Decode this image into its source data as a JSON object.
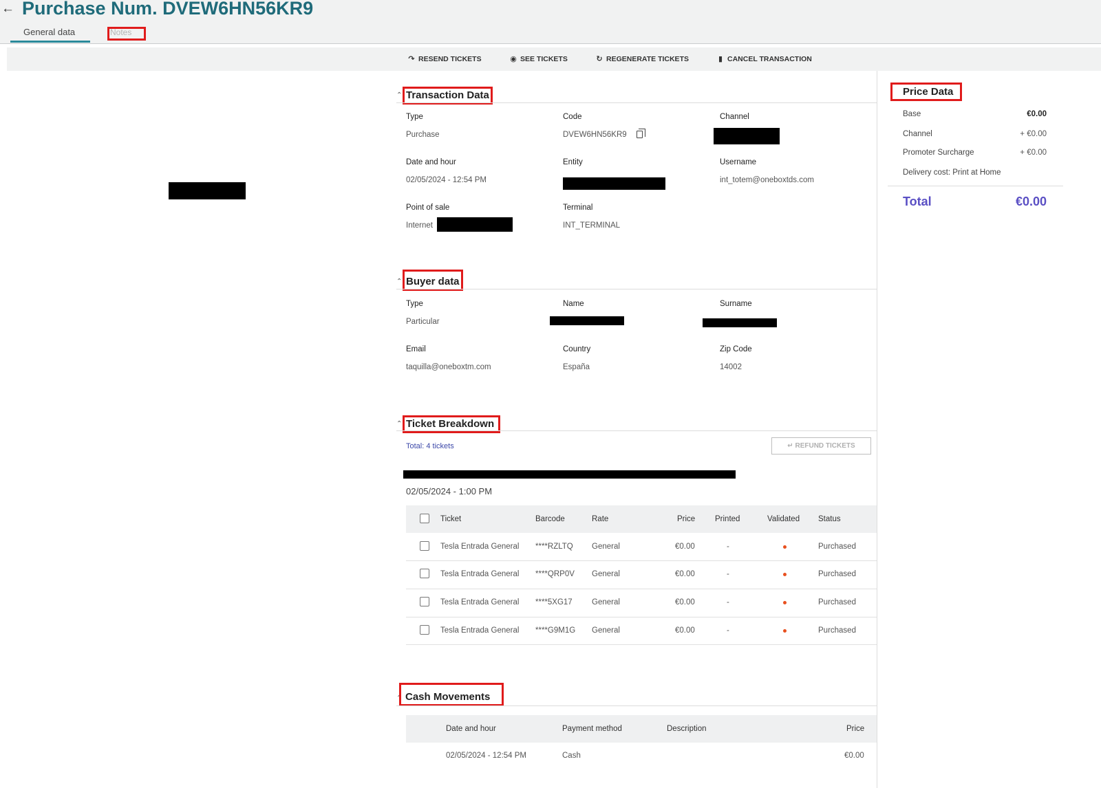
{
  "header": {
    "back_icon": "arrow-left-icon",
    "title": "Purchase Num. DVEW6HN56KR9",
    "tabs": [
      {
        "label": "General data",
        "active": true
      },
      {
        "label": "Notes",
        "active": false
      }
    ]
  },
  "toolbar": {
    "actions": [
      {
        "icon": "resend-icon",
        "label": "RESEND TICKETS"
      },
      {
        "icon": "eye-icon",
        "label": "SEE TICKETS"
      },
      {
        "icon": "refresh-icon",
        "label": "REGENERATE TICKETS"
      },
      {
        "icon": "trash-icon",
        "label": "CANCEL TRANSACTION"
      }
    ]
  },
  "transaction": {
    "title": "Transaction Data",
    "type_label": "Type",
    "type_value": "Purchase",
    "code_label": "Code",
    "code_value": "DVEW6HN56KR9",
    "channel_label": "Channel",
    "date_label": "Date and hour",
    "date_value": "02/05/2024 - 12:54 PM",
    "entity_label": "Entity",
    "username_label": "Username",
    "username_value": "int_totem@oneboxtds.com",
    "pos_label": "Point of sale",
    "pos_value": "Internet",
    "terminal_label": "Terminal",
    "terminal_value": "INT_TERMINAL"
  },
  "buyer": {
    "title": "Buyer data",
    "type_label": "Type",
    "type_value": "Particular",
    "name_label": "Name",
    "surname_label": "Surname",
    "email_label": "Email",
    "email_value": "taquilla@oneboxtm.com",
    "country_label": "Country",
    "country_value": "España",
    "zip_label": "Zip Code",
    "zip_value": "14002"
  },
  "tickets": {
    "title": "Ticket Breakdown",
    "total_text": "Total: 4 tickets",
    "refund_label": "REFUND TICKETS",
    "session_date": "02/05/2024 - 1:00 PM",
    "columns": [
      "Ticket",
      "Barcode",
      "Rate",
      "Price",
      "Printed",
      "Validated",
      "Status"
    ],
    "rows": [
      {
        "ticket": "Tesla Entrada General",
        "barcode": "****RZLTQ",
        "rate": "General",
        "price": "€0.00",
        "printed": "-",
        "status": "Purchased"
      },
      {
        "ticket": "Tesla Entrada General",
        "barcode": "****QRP0V",
        "rate": "General",
        "price": "€0.00",
        "printed": "-",
        "status": "Purchased"
      },
      {
        "ticket": "Tesla Entrada General",
        "barcode": "****5XG17",
        "rate": "General",
        "price": "€0.00",
        "printed": "-",
        "status": "Purchased"
      },
      {
        "ticket": "Tesla Entrada General",
        "barcode": "****G9M1G",
        "rate": "General",
        "price": "€0.00",
        "printed": "-",
        "status": "Purchased"
      }
    ],
    "validated_dot_color": "#e8501f"
  },
  "cash": {
    "title": "Cash Movements",
    "columns": [
      "Date and hour",
      "Payment method",
      "Description",
      "Price"
    ],
    "rows": [
      {
        "date": "02/05/2024 - 12:54 PM",
        "method": "Cash",
        "description": "",
        "price": "€0.00"
      }
    ]
  },
  "price": {
    "title": "Price Data",
    "lines": [
      {
        "label": "Base",
        "value": "€0.00"
      },
      {
        "label": "Channel",
        "value": "+ €0.00"
      },
      {
        "label": "Promoter Surcharge",
        "value": "+ €0.00"
      },
      {
        "label": "Delivery cost: Print at Home",
        "value": ""
      }
    ],
    "total_label": "Total",
    "total_value": "€0.00"
  },
  "colors": {
    "title": "#1f6b7a",
    "accent": "#2a8a9a",
    "link": "#3b47a8",
    "total": "#5a4fc4",
    "highlight": "#e01b1b"
  }
}
